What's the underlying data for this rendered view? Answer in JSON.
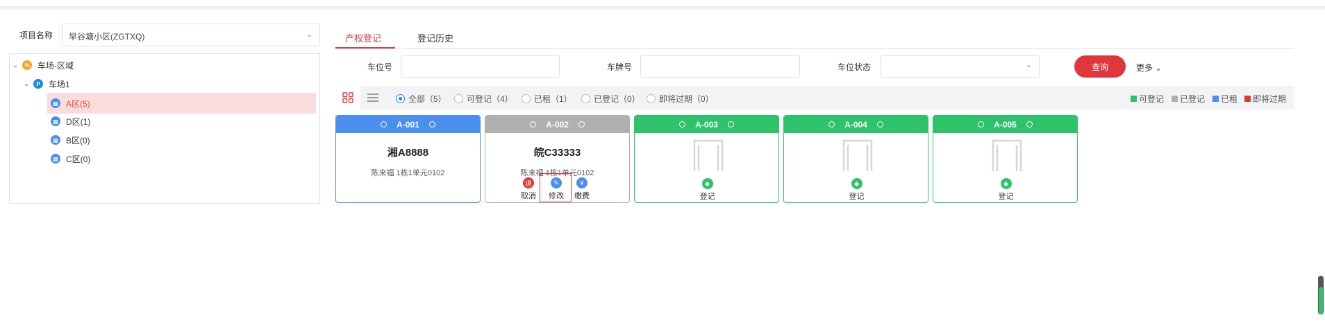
{
  "project": {
    "label": "项目名称",
    "selected": "早谷塘小区(ZGTXQ)"
  },
  "tree": {
    "root": "车场-区域",
    "lot": "车场1",
    "areas": [
      "A区(5)",
      "D区(1)",
      "B区(0)",
      "C区(0)"
    ]
  },
  "tabs": [
    "产权登记",
    "登记历史"
  ],
  "filters": {
    "space_label": "车位号",
    "plate_label": "车牌号",
    "status_label": "车位状态",
    "query": "查询",
    "more": "更多"
  },
  "statusFilters": [
    "全部（5）",
    "可登记（4）",
    "已租（1）",
    "已登记（0）",
    "即将过期（0）"
  ],
  "legend": [
    {
      "label": "可登记",
      "color": "#2ec36b"
    },
    {
      "label": "已登记",
      "color": "#b0b0b0"
    },
    {
      "label": "已租",
      "color": "#4a8ef0"
    },
    {
      "label": "即将过期",
      "color": "#e0383a"
    }
  ],
  "cards": [
    {
      "code": "A-001",
      "color": "#4a8ef0",
      "plate": "湘A8888",
      "owner": "陈来福  1栋1单元0102"
    },
    {
      "code": "A-002",
      "color": "#b0b0b0",
      "plate": "皖C33333",
      "owner": "陈来福  1栋1单元0102",
      "actions": [
        {
          "label": "取消",
          "icon": "退",
          "color": "#e0383a"
        },
        {
          "label": "修改",
          "icon": "✎",
          "color": "#4a8ef0"
        },
        {
          "label": "缴费",
          "icon": "¥",
          "color": "#4a8ef0"
        }
      ]
    },
    {
      "code": "A-003",
      "color": "#2ec36b",
      "register": "登记"
    },
    {
      "code": "A-004",
      "color": "#2ec36b",
      "register": "登记"
    },
    {
      "code": "A-005",
      "color": "#2ec36b",
      "register": "登记"
    }
  ]
}
